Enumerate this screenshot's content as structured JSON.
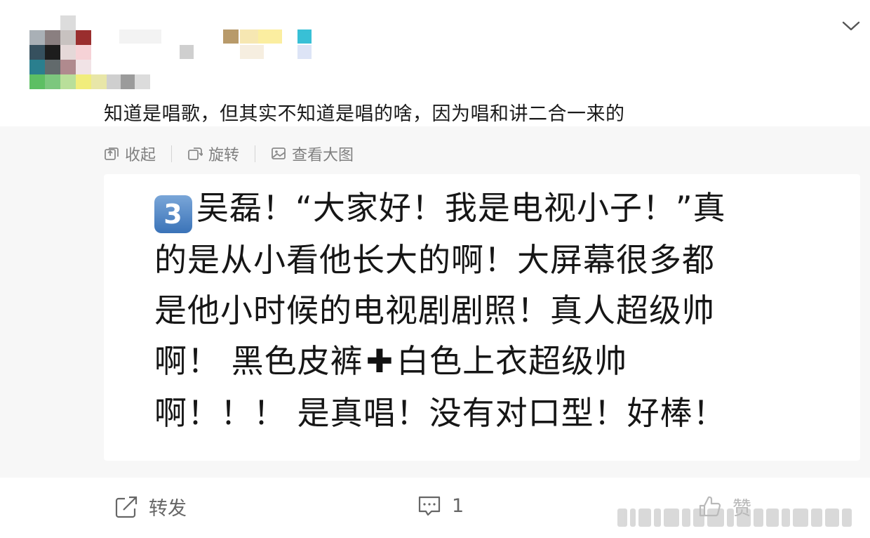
{
  "post": {
    "text": "知道是唱歌，但其实不知道是唱的啥，因为唱和讲二合一来的"
  },
  "media_toolbar": {
    "collapse_label": "收起",
    "rotate_label": "旋转",
    "view_large_label": "查看大图"
  },
  "image_text": {
    "badge": "3",
    "line1": "吴磊！“大家好！我是电视小子！”真",
    "line2": "的是从小看他长大的啊！大屏幕很多都",
    "line3": "是他小时候的电视剧剧照！真人超级帅",
    "line4a": "啊！ 黑色皮裤",
    "plus": "✚",
    "line4b": "白色上衣超级帅",
    "line5": "啊！！！ 是真唱！没有对口型！好棒！"
  },
  "footer": {
    "repost_label": "转发",
    "comment_count": "1",
    "like_label": "赞"
  },
  "icons": {
    "chevron": "chevron-down-icon",
    "collapse": "collapse-icon",
    "rotate": "rotate-icon",
    "view_large": "image-icon",
    "repost": "repost-icon",
    "comment": "comment-icon",
    "like": "like-icon"
  },
  "colors": {
    "toolbar_text": "#808080",
    "media_bg": "#f7f7f7",
    "badge": "#4a80c0"
  }
}
